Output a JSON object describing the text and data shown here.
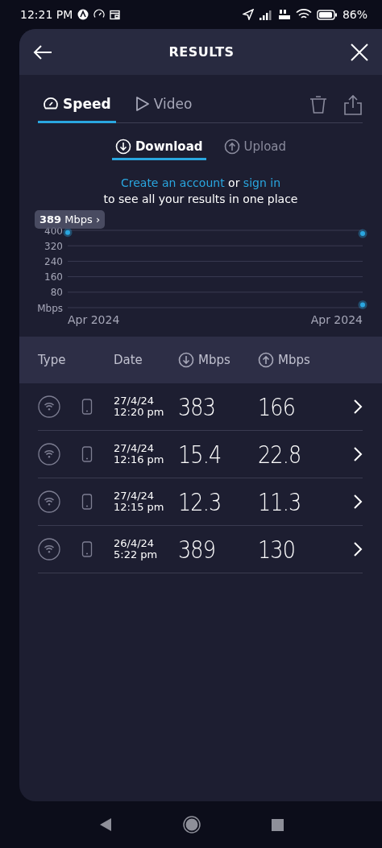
{
  "status_bar": {
    "time": "12:21 PM",
    "battery": "86%"
  },
  "header": {
    "title": "RESULTS"
  },
  "tabs": [
    {
      "label": "Speed",
      "kind": "speed",
      "selected": true
    },
    {
      "label": "Video",
      "kind": "video",
      "selected": false
    }
  ],
  "direction_tabs": [
    {
      "label": "Download",
      "kind": "download",
      "selected": true
    },
    {
      "label": "Upload",
      "kind": "upload",
      "selected": false
    }
  ],
  "account_prompt": {
    "create_link": "Create an account",
    "connector": "or",
    "sign_in_link": "sign in",
    "text": "to see all your results in one place"
  },
  "chart": {
    "tooltip": {
      "value": "389",
      "unit": "Mbps",
      "arrow": "›"
    },
    "chart_data": {
      "type": "scatter",
      "grid": true,
      "ylabel": "Mbps",
      "ylim": [
        0,
        400
      ],
      "yticks": [
        80,
        160,
        240,
        320,
        400
      ],
      "categories": [
        "Apr 2024",
        "Apr 2024"
      ],
      "series": [
        {
          "color": "#2aa7e0",
          "values": [
            389,
            383
          ]
        },
        {
          "color": "#2aa7e0",
          "values": [
            null,
            15
          ]
        }
      ]
    }
  },
  "table": {
    "columns": [
      {
        "label": "Type",
        "kind": "text"
      },
      {
        "label": "Date",
        "kind": "text"
      },
      {
        "label": "Mbps",
        "kind": "download"
      },
      {
        "label": "Mbps",
        "kind": "upload"
      }
    ],
    "rows": [
      {
        "date": "27/4/24",
        "time": "12:20 pm",
        "download": "383",
        "upload": "166"
      },
      {
        "date": "27/4/24",
        "time": "12:16 pm",
        "download": "15.4",
        "upload": "22.8"
      },
      {
        "date": "27/4/24",
        "time": "12:15 pm",
        "download": "12.3",
        "upload": "11.3"
      },
      {
        "date": "26/4/24",
        "time": "5:22 pm",
        "download": "389",
        "upload": "130"
      }
    ]
  }
}
